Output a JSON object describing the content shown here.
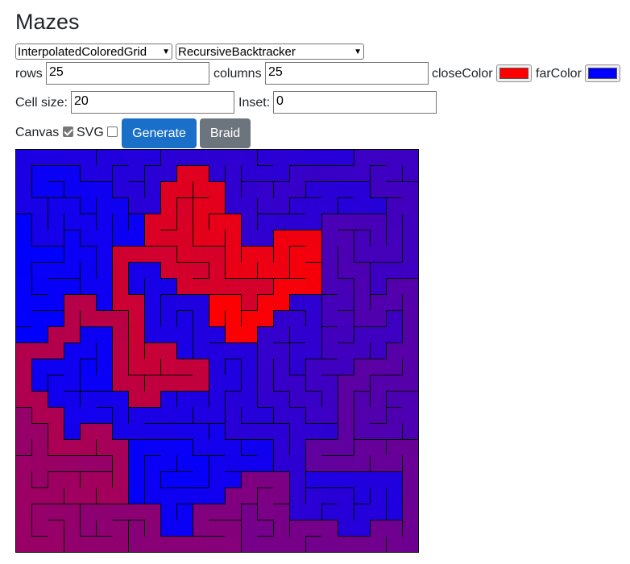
{
  "page": {
    "title": "Mazes"
  },
  "controls": {
    "grid_type": "InterpolatedColoredGrid",
    "algorithm": "RecursiveBacktracker",
    "rows_label": "rows",
    "rows_value": "25",
    "columns_label": "columns",
    "columns_value": "25",
    "close_color_label": "closeColor",
    "close_color": "#ff0000",
    "far_color_label": "farColor",
    "far_color": "#0000ff",
    "cell_size_label": "Cell size:",
    "cell_size_value": "20",
    "inset_label": "Inset:",
    "inset_value": "0",
    "canvas_label": "Canvas",
    "canvas_checked": true,
    "svg_label": "SVG",
    "svg_checked": false,
    "generate_label": "Generate",
    "braid_label": "Braid",
    "generate_color": "#1a6fc9",
    "braid_color": "#6c757d"
  },
  "maze": {
    "rows": 25,
    "columns": 25,
    "wall_color": "#000000"
  }
}
